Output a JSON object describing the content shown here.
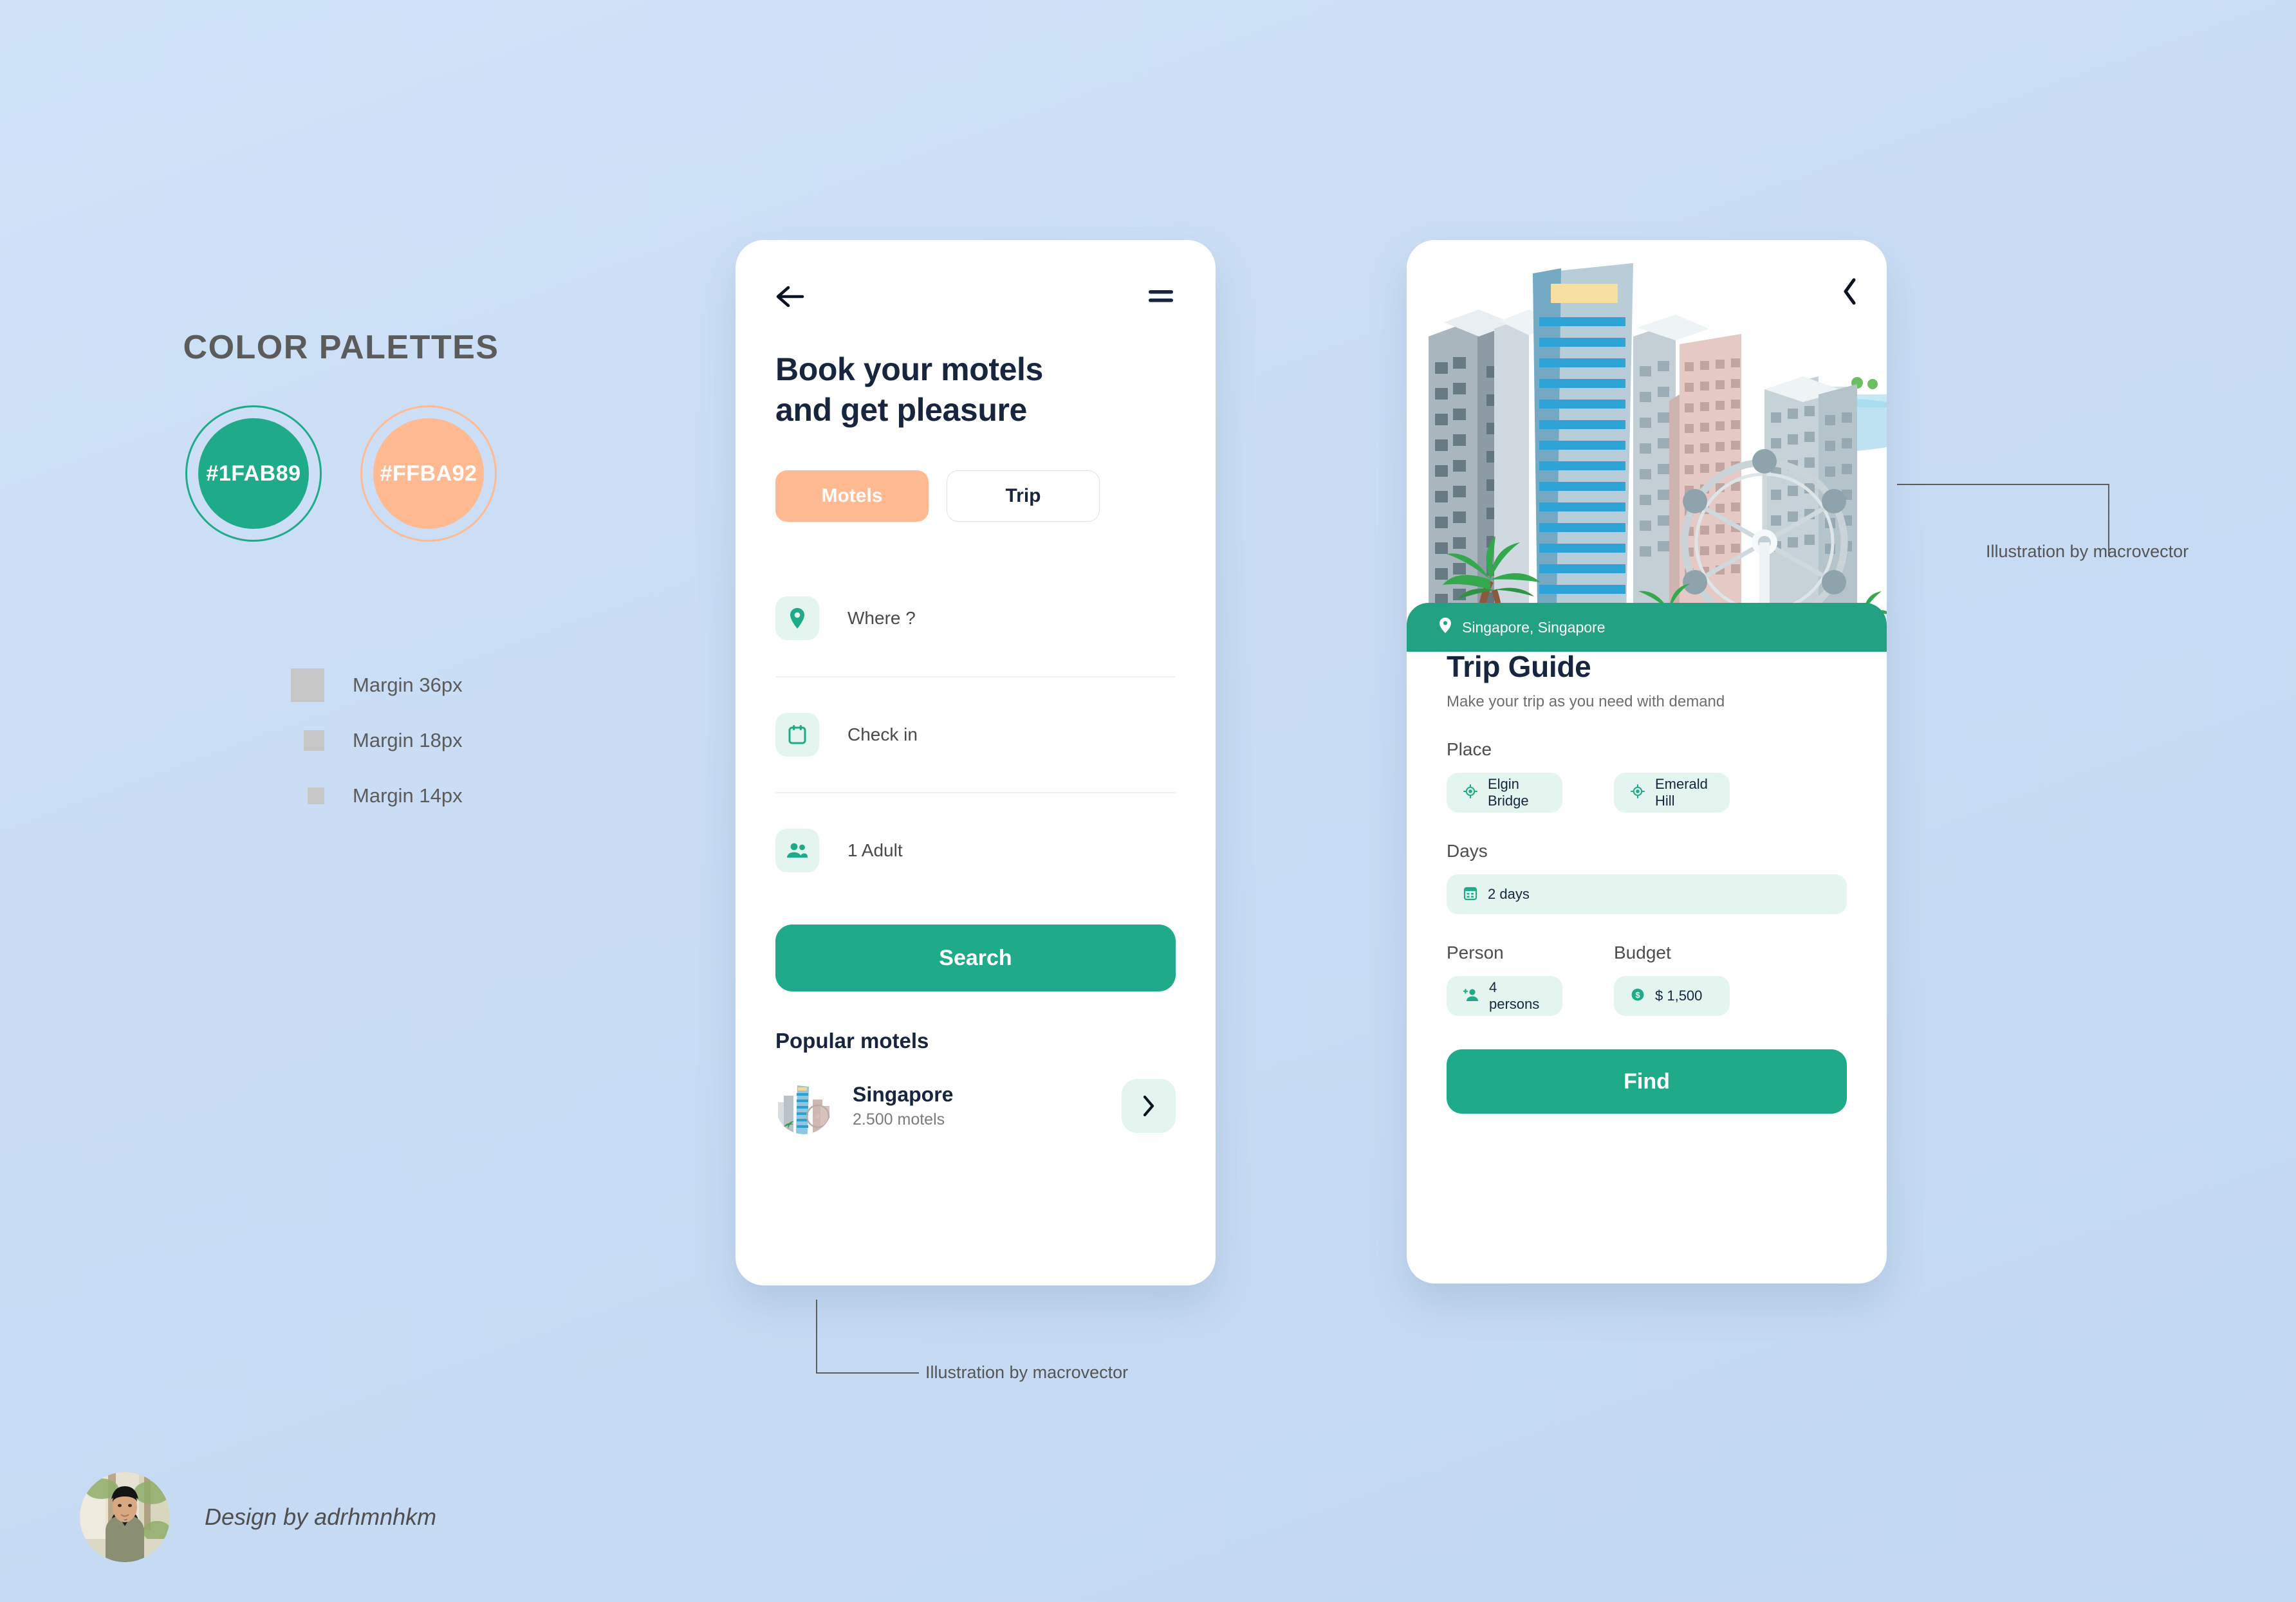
{
  "palette": {
    "title": "COLOR PALETTES",
    "swatches": [
      {
        "hex": "#1FAB89",
        "label": "#1FAB89"
      },
      {
        "hex": "#FFBA92",
        "label": "#FFBA92"
      }
    ],
    "margins": [
      {
        "label": "Margin 36px",
        "size": 36
      },
      {
        "label": "Margin 18px",
        "size": 18
      },
      {
        "label": "Margin 14px",
        "size": 14
      }
    ],
    "margin_swatch_color": "#c6c6c6"
  },
  "booking_screen": {
    "back_icon": "arrow-left-icon",
    "menu_icon": "hamburger-menu-icon",
    "title": "Book your motels and get pleasure",
    "title_line1": "Book your motels",
    "title_line2": "and get pleasure",
    "tabs": [
      {
        "label": "Motels",
        "active": true
      },
      {
        "label": "Trip",
        "active": false
      }
    ],
    "fields": [
      {
        "icon": "location-pin-icon",
        "value": "Where ?"
      },
      {
        "icon": "calendar-icon",
        "value": "Check in"
      },
      {
        "icon": "people-icon",
        "value": "1 Adult"
      }
    ],
    "search_label": "Search",
    "popular_heading": "Popular motels",
    "popular_items": [
      {
        "name": "Singapore",
        "subtitle": "2.500 motels",
        "chevron": "chevron-right-icon"
      }
    ]
  },
  "trip_screen": {
    "back_icon": "chevron-left-icon",
    "location_icon": "location-pin-icon",
    "location": "Singapore, Singapore",
    "title": "Trip Guide",
    "subtitle": "Make your trip as you need with demand",
    "groups": [
      {
        "label": "Place",
        "chips": [
          {
            "icon": "gps-target-icon",
            "value": "Elgin Bridge"
          },
          {
            "icon": "gps-target-icon",
            "value": "Emerald Hill"
          }
        ]
      },
      {
        "label": "Days",
        "chips": [
          {
            "icon": "calendar-days-icon",
            "value": "2 days"
          }
        ]
      }
    ],
    "person_label": "Person",
    "person_chip": {
      "icon": "person-add-icon",
      "value": "4 persons"
    },
    "budget_label": "Budget",
    "budget_chip": {
      "icon": "dollar-circle-icon",
      "value": "$ 1,500"
    },
    "find_label": "Find"
  },
  "annotations": {
    "illustration_credit_left": "Illustration by macrovector",
    "illustration_credit_right": "Illustration by macrovector"
  },
  "credit": {
    "text": "Design by adrhmnhkm"
  },
  "colors": {
    "background": "#cfe2f8",
    "green": "#1FAB89",
    "green_band": "#23A183",
    "peach": "#FFBA92",
    "mint": "#e3f5ee",
    "navy": "#17253f",
    "gray_text": "#5b5b5b"
  }
}
